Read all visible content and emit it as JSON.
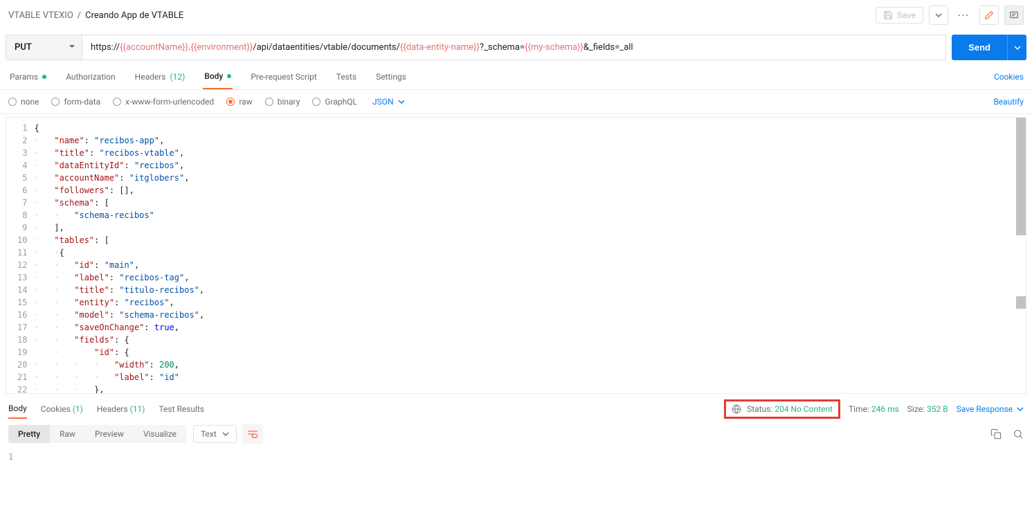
{
  "breadcrumb": {
    "collection": "VTABLE VTEXIO",
    "sep": "/",
    "current": "Creando App de VTABLE"
  },
  "topbar": {
    "save": "Save"
  },
  "request": {
    "method": "PUT",
    "url": {
      "p1": "https://",
      "v1": "{{accountName}}",
      "p2": ".",
      "v2": "{{environment}}",
      "p3": "/api/dataentities/vtable/documents/",
      "v3": "{{data-entity-name}}",
      "p4": "?_schema=",
      "v4": "{{my-schema}}",
      "p5": "&_fields=_all"
    },
    "send": "Send"
  },
  "tabs": {
    "params": "Params",
    "auth": "Authorization",
    "headers": "Headers",
    "headers_count": "(12)",
    "body": "Body",
    "prereq": "Pre-request Script",
    "tests": "Tests",
    "settings": "Settings",
    "cookies": "Cookies"
  },
  "body_types": {
    "none": "none",
    "formdata": "form-data",
    "urlencoded": "x-www-form-urlencoded",
    "raw": "raw",
    "binary": "binary",
    "graphql": "GraphQL",
    "lang": "JSON",
    "beautify": "Beautify"
  },
  "code_lines": [
    [
      {
        "t": "{",
        "c": ""
      }
    ],
    [
      {
        "t": "····",
        "c": "guide"
      },
      {
        "t": "\"name\"",
        "c": "s-key"
      },
      {
        "t": ": ",
        "c": ""
      },
      {
        "t": "\"recibos-app\"",
        "c": "s-str"
      },
      {
        "t": ",",
        "c": ""
      }
    ],
    [
      {
        "t": "····",
        "c": "guide"
      },
      {
        "t": "\"title\"",
        "c": "s-key"
      },
      {
        "t": ": ",
        "c": ""
      },
      {
        "t": "\"recibos-vtable\"",
        "c": "s-str"
      },
      {
        "t": ",",
        "c": ""
      }
    ],
    [
      {
        "t": "····",
        "c": "guide"
      },
      {
        "t": "\"dataEntityId\"",
        "c": "s-key"
      },
      {
        "t": ": ",
        "c": ""
      },
      {
        "t": "\"recibos\"",
        "c": "s-str"
      },
      {
        "t": ",",
        "c": ""
      }
    ],
    [
      {
        "t": "····",
        "c": "guide"
      },
      {
        "t": "\"accountName\"",
        "c": "s-key"
      },
      {
        "t": ": ",
        "c": ""
      },
      {
        "t": "\"itglobers\"",
        "c": "s-str"
      },
      {
        "t": ",",
        "c": ""
      }
    ],
    [
      {
        "t": "····",
        "c": "guide"
      },
      {
        "t": "\"followers\"",
        "c": "s-key"
      },
      {
        "t": ": [],",
        "c": ""
      }
    ],
    [
      {
        "t": "····",
        "c": "guide"
      },
      {
        "t": "\"schema\"",
        "c": "s-key"
      },
      {
        "t": ": [",
        "c": ""
      }
    ],
    [
      {
        "t": "····",
        "c": "guide"
      },
      {
        "t": "····",
        "c": "guide"
      },
      {
        "t": "\"schema-recibos\"",
        "c": "s-str"
      }
    ],
    [
      {
        "t": "····",
        "c": "guide"
      },
      {
        "t": "],",
        "c": ""
      }
    ],
    [
      {
        "t": "····",
        "c": "guide"
      },
      {
        "t": "\"tables\"",
        "c": "s-key"
      },
      {
        "t": ": [",
        "c": ""
      }
    ],
    [
      {
        "t": "····",
        "c": "guide"
      },
      {
        "t": "·{",
        "c": "guide-open"
      }
    ],
    [
      {
        "t": "····",
        "c": "guide"
      },
      {
        "t": "····",
        "c": "guide"
      },
      {
        "t": "\"id\"",
        "c": "s-key"
      },
      {
        "t": ": ",
        "c": ""
      },
      {
        "t": "\"main\"",
        "c": "s-str"
      },
      {
        "t": ",",
        "c": ""
      }
    ],
    [
      {
        "t": "····",
        "c": "guide"
      },
      {
        "t": "····",
        "c": "guide"
      },
      {
        "t": "\"label\"",
        "c": "s-key"
      },
      {
        "t": ": ",
        "c": ""
      },
      {
        "t": "\"recibos-tag\"",
        "c": "s-str"
      },
      {
        "t": ",",
        "c": ""
      }
    ],
    [
      {
        "t": "····",
        "c": "guide"
      },
      {
        "t": "····",
        "c": "guide"
      },
      {
        "t": "\"title\"",
        "c": "s-key"
      },
      {
        "t": ": ",
        "c": ""
      },
      {
        "t": "\"titulo-recibos\"",
        "c": "s-str"
      },
      {
        "t": ",",
        "c": ""
      }
    ],
    [
      {
        "t": "····",
        "c": "guide"
      },
      {
        "t": "····",
        "c": "guide"
      },
      {
        "t": "\"entity\"",
        "c": "s-key"
      },
      {
        "t": ": ",
        "c": ""
      },
      {
        "t": "\"recibos\"",
        "c": "s-str"
      },
      {
        "t": ",",
        "c": ""
      }
    ],
    [
      {
        "t": "····",
        "c": "guide"
      },
      {
        "t": "····",
        "c": "guide"
      },
      {
        "t": "\"model\"",
        "c": "s-key"
      },
      {
        "t": ": ",
        "c": ""
      },
      {
        "t": "\"schema-recibos\"",
        "c": "s-str"
      },
      {
        "t": ",",
        "c": ""
      }
    ],
    [
      {
        "t": "····",
        "c": "guide"
      },
      {
        "t": "····",
        "c": "guide"
      },
      {
        "t": "\"saveOnChange\"",
        "c": "s-key"
      },
      {
        "t": ": ",
        "c": ""
      },
      {
        "t": "true",
        "c": "s-bool"
      },
      {
        "t": ",",
        "c": ""
      }
    ],
    [
      {
        "t": "····",
        "c": "guide"
      },
      {
        "t": "····",
        "c": "guide"
      },
      {
        "t": "\"fields\"",
        "c": "s-key"
      },
      {
        "t": ": {",
        "c": ""
      }
    ],
    [
      {
        "t": "····",
        "c": "guide"
      },
      {
        "t": "····",
        "c": "guide"
      },
      {
        "t": "····",
        "c": "guide"
      },
      {
        "t": "\"id\"",
        "c": "s-key"
      },
      {
        "t": ": {",
        "c": ""
      }
    ],
    [
      {
        "t": "····",
        "c": "guide"
      },
      {
        "t": "····",
        "c": "guide"
      },
      {
        "t": "····",
        "c": "guide"
      },
      {
        "t": "····",
        "c": "guide"
      },
      {
        "t": "\"width\"",
        "c": "s-key"
      },
      {
        "t": ": ",
        "c": ""
      },
      {
        "t": "200",
        "c": "s-num"
      },
      {
        "t": ",",
        "c": ""
      }
    ],
    [
      {
        "t": "····",
        "c": "guide"
      },
      {
        "t": "····",
        "c": "guide"
      },
      {
        "t": "····",
        "c": "guide"
      },
      {
        "t": "····",
        "c": "guide"
      },
      {
        "t": "\"label\"",
        "c": "s-key"
      },
      {
        "t": ": ",
        "c": ""
      },
      {
        "t": "\"id\"",
        "c": "s-str"
      }
    ],
    [
      {
        "t": "····",
        "c": "guide"
      },
      {
        "t": "····",
        "c": "guide"
      },
      {
        "t": "····",
        "c": "guide"
      },
      {
        "t": "},",
        "c": ""
      }
    ]
  ],
  "response": {
    "tabs": {
      "body": "Body",
      "cookies": "Cookies",
      "cookies_count": "(1)",
      "headers": "Headers",
      "headers_count": "(11)",
      "tests": "Test Results"
    },
    "status_label": "Status:",
    "status_value": "204 No Content",
    "time_label": "Time:",
    "time_value": "246 ms",
    "size_label": "Size:",
    "size_value": "352 B",
    "save": "Save Response",
    "view": {
      "pretty": "Pretty",
      "raw": "Raw",
      "preview": "Preview",
      "visualize": "Visualize",
      "lang": "Text"
    },
    "line1": "1"
  }
}
